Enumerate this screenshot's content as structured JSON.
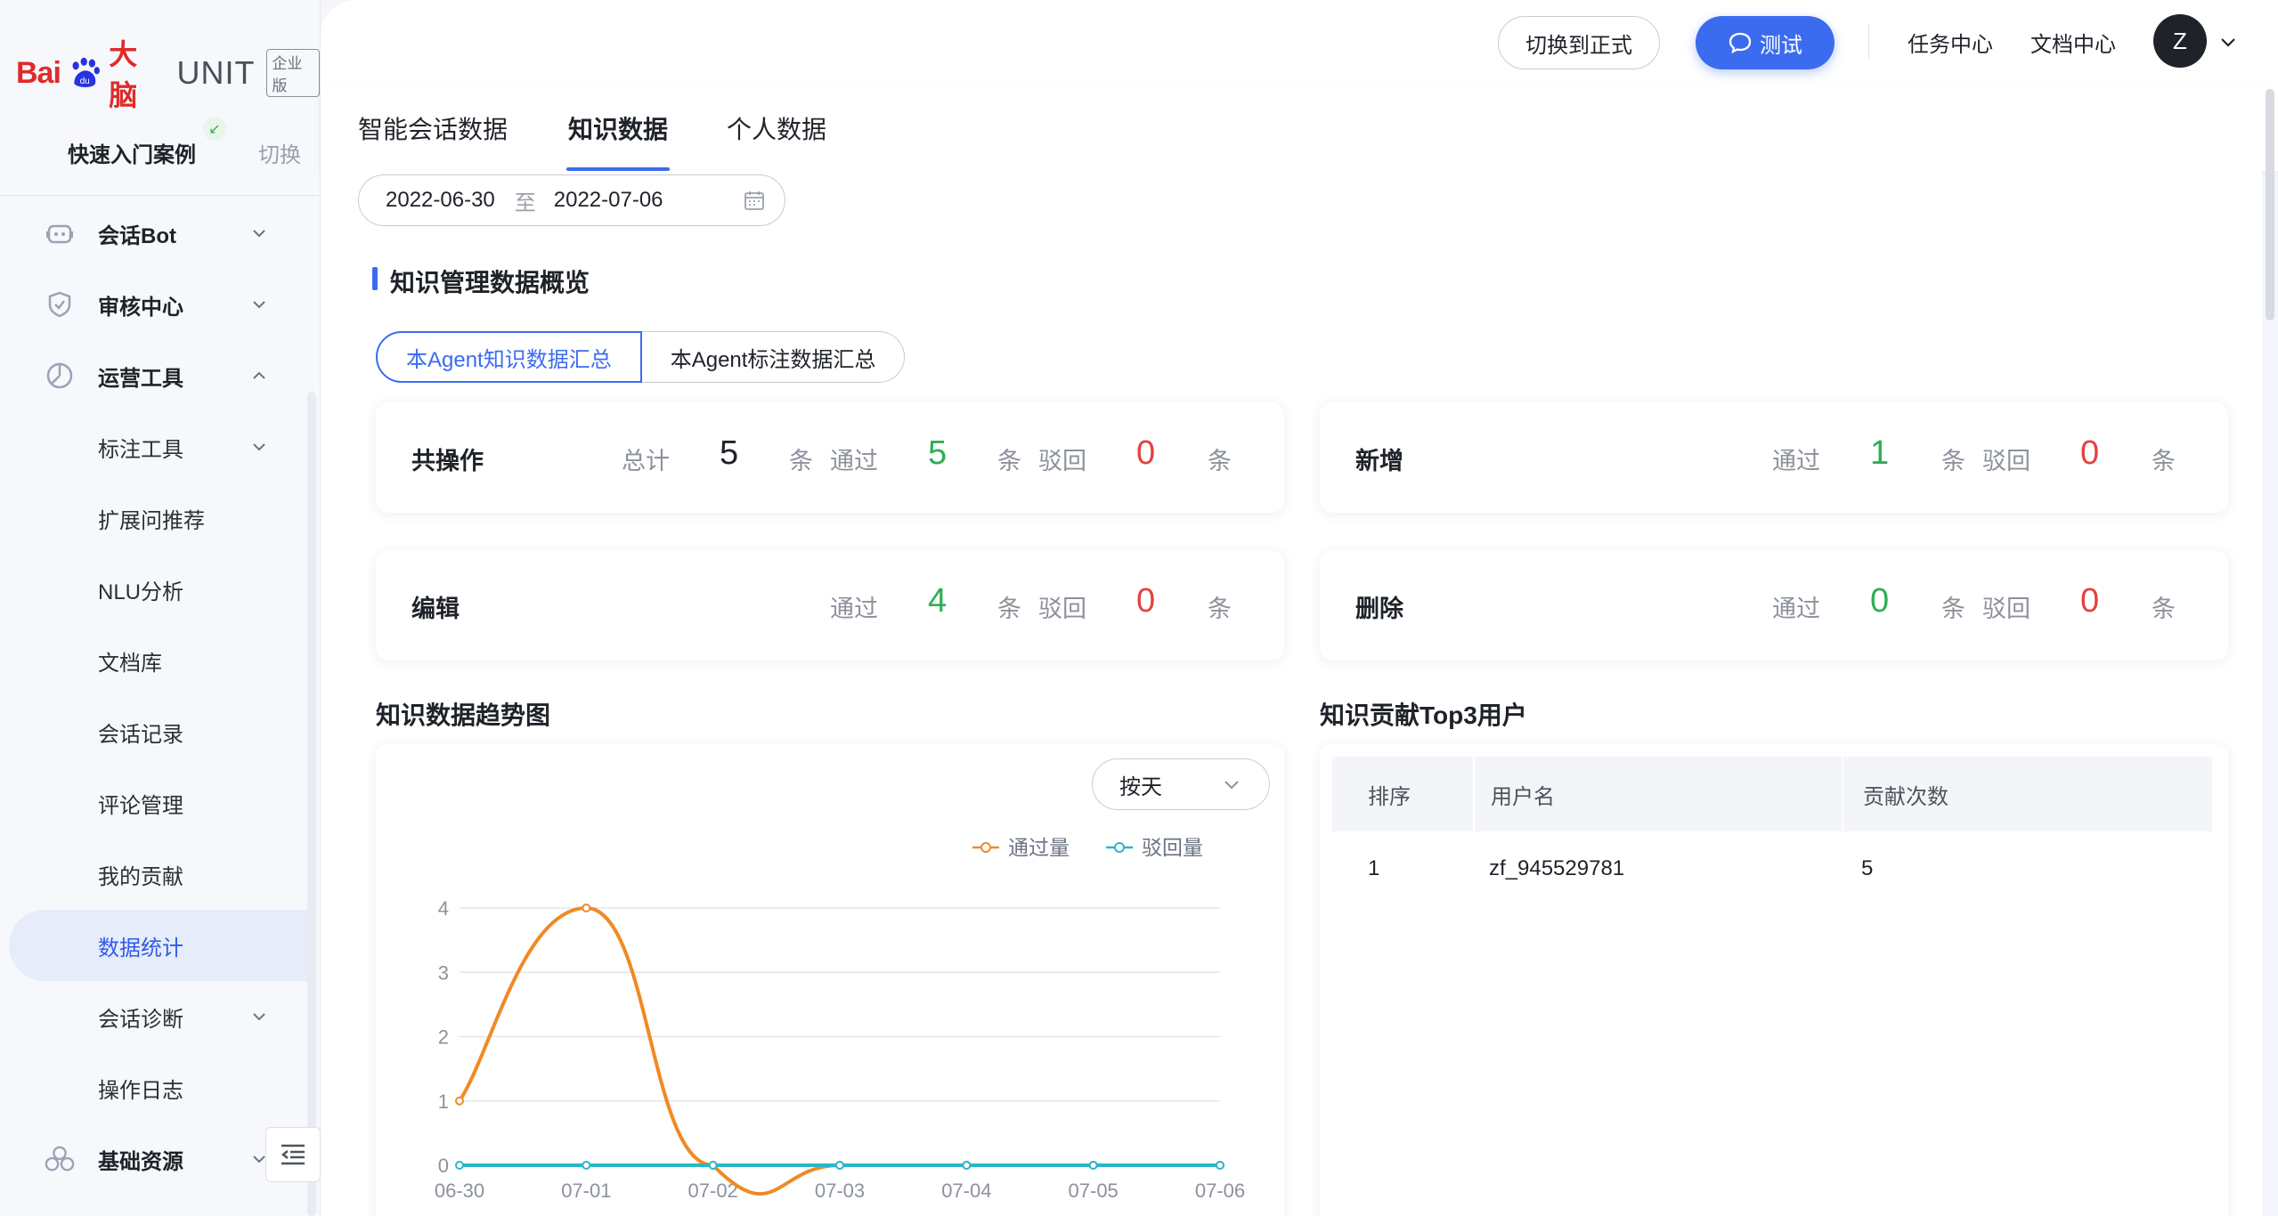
{
  "brand": {
    "bai": "Bai",
    "du": "du",
    "danao": "大脑",
    "unit": "UNIT",
    "edition": "企业版"
  },
  "quick": {
    "label": "快速入门案例",
    "switch": "切换"
  },
  "nav": [
    {
      "label": "会话Bot",
      "icon": "robot-icon",
      "chevron": "down"
    },
    {
      "label": "审核中心",
      "icon": "shield-icon",
      "chevron": "down"
    },
    {
      "label": "运营工具",
      "icon": "pie-chart-icon",
      "chevron": "up"
    },
    {
      "label": "标注工具",
      "chevron": "down"
    },
    {
      "label": "扩展问推荐"
    },
    {
      "label": "NLU分析"
    },
    {
      "label": "文档库"
    },
    {
      "label": "会话记录"
    },
    {
      "label": "评论管理"
    },
    {
      "label": "我的贡献"
    },
    {
      "label": "数据统计",
      "active": true
    },
    {
      "label": "会话诊断",
      "chevron": "down"
    },
    {
      "label": "操作日志"
    },
    {
      "label": "基础资源",
      "icon": "cubes-icon",
      "chevron": "down"
    }
  ],
  "topbar": {
    "switch_label": "切换到正式",
    "test_label": "测试",
    "task_center": "任务中心",
    "doc_center": "文档中心",
    "avatar_initial": "Z"
  },
  "tabs": [
    "智能会话数据",
    "知识数据",
    "个人数据"
  ],
  "date_range": {
    "start": "2022-06-30",
    "sep": "至",
    "end": "2022-07-06"
  },
  "overview": {
    "title": "知识管理数据概览",
    "segments": [
      "本Agent知识数据汇总",
      "本Agent标注数据汇总"
    ],
    "cards": {
      "total": {
        "title": "共操作",
        "total_label": "总计",
        "total": "5",
        "unit": "条",
        "pass_label": "通过",
        "pass": "5",
        "reject_label": "驳回",
        "reject": "0"
      },
      "add": {
        "title": "新增",
        "pass_label": "通过",
        "pass": "1",
        "unit": "条",
        "reject_label": "驳回",
        "reject": "0"
      },
      "edit": {
        "title": "编辑",
        "pass_label": "通过",
        "pass": "4",
        "unit": "条",
        "reject_label": "驳回",
        "reject": "0"
      },
      "delete": {
        "title": "删除",
        "pass_label": "通过",
        "pass": "0",
        "unit": "条",
        "reject_label": "驳回",
        "reject": "0"
      }
    }
  },
  "trend": {
    "title": "知识数据趋势图",
    "granularity": "按天"
  },
  "top3": {
    "title": "知识贡献Top3用户",
    "headers": [
      "排序",
      "用户名",
      "贡献次数"
    ],
    "rows": [
      {
        "rank": "1",
        "user": "zf_945529781",
        "count": "5"
      }
    ]
  },
  "chart_data": {
    "type": "line",
    "x": [
      "06-30",
      "07-01",
      "07-02",
      "07-03",
      "07-04",
      "07-05",
      "07-06"
    ],
    "series": [
      {
        "name": "通过量",
        "color": "#f08a24",
        "values": [
          1,
          4,
          0,
          0,
          0,
          0,
          0
        ]
      },
      {
        "name": "驳回量",
        "color": "#2bb6c8",
        "values": [
          0,
          0,
          0,
          0,
          0,
          0,
          0
        ]
      }
    ],
    "ylim": [
      0,
      4
    ],
    "yticks": [
      0,
      1,
      2,
      3,
      4
    ],
    "legend": "top-right",
    "grid": true
  }
}
